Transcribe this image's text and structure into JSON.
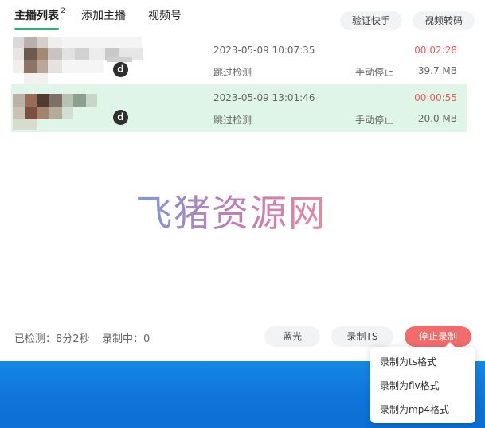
{
  "tabs": [
    {
      "label": "主播列表",
      "badge": "2"
    },
    {
      "label": "添加主播"
    },
    {
      "label": "视频号"
    }
  ],
  "top_buttons": {
    "verify": "验证快手",
    "transcode": "视频转码"
  },
  "records": [
    {
      "platform_icon": "d",
      "datetime": "2023-05-09 10:07:35",
      "status": "跳过检测",
      "stop_mode": "手动停止",
      "duration": "00:02:28",
      "size": "39.7 MB",
      "selected": false
    },
    {
      "platform_icon": "d",
      "datetime": "2023-05-09 13:01:46",
      "status": "跳过检测",
      "stop_mode": "手动停止",
      "duration": "00:00:55",
      "size": "20.0 MB",
      "selected": true
    }
  ],
  "watermark": "飞猪资源网",
  "footer": {
    "checked": "已检测：8分2秒",
    "recording": "录制中：0",
    "bluray": "蓝光",
    "record_ts": "录制TS",
    "stop_record": "停止录制"
  },
  "dropdown": {
    "items": [
      "录制为ts格式",
      "录制为flv格式",
      "录制为mp4格式"
    ]
  },
  "colors": {
    "accent": "#2fb07a",
    "danger": "#f26c6c",
    "duration": "#f05a5a",
    "selected_row": "#dff5e8",
    "taskbar_blue": "#0e74d8"
  }
}
